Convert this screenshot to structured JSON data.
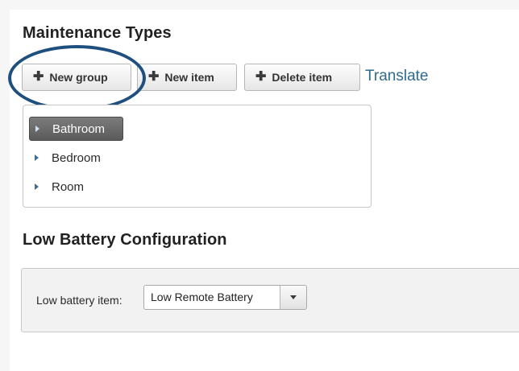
{
  "maintenance": {
    "title": "Maintenance Types",
    "toolbar": {
      "new_group_label": "New group",
      "new_item_label": "New item",
      "delete_item_label": "Delete item",
      "translate_label": "Translate",
      "plus_icon": "plus-icon"
    },
    "tree": {
      "items": [
        {
          "label": "Bathroom",
          "selected": true
        },
        {
          "label": "Bedroom",
          "selected": false
        },
        {
          "label": "Room",
          "selected": false
        }
      ]
    }
  },
  "low_battery": {
    "title": "Low Battery Configuration",
    "item_label": "Low battery item:",
    "selected_value": "Low Remote Battery"
  },
  "colors": {
    "link": "#2e6b8f",
    "highlight_ring": "#1f4f7f",
    "selected_item_bg": "#6b6b6b"
  }
}
